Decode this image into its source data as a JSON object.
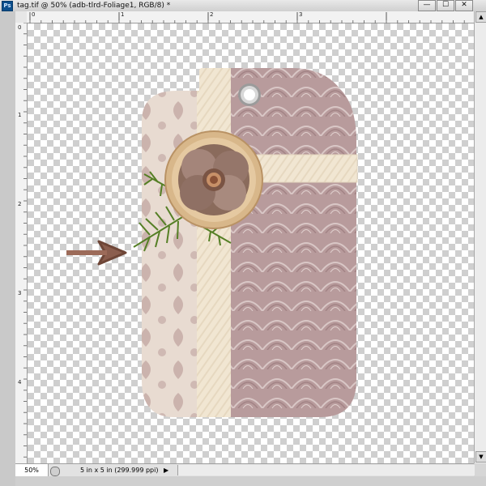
{
  "window": {
    "app_icon": "Ps",
    "title": "tag.tif @ 50% (adb-tlrd-Foliage1, RGB/8) *",
    "controls": [
      "—",
      "☐",
      "✕"
    ]
  },
  "ruler": {
    "h_labels": [
      "0",
      "1",
      "2",
      "3"
    ],
    "v_labels": [
      "0",
      "1",
      "2",
      "3",
      "4"
    ]
  },
  "status": {
    "zoom": "50%",
    "doc_info": "5 in x 5 in (299.999 ppi)",
    "arrow": "▶"
  },
  "colors": {
    "tag_left": "#e7d9d0",
    "tag_right": "#b99a9b",
    "ribbon": "#f1e6d2",
    "arrow": "#8b5e4e",
    "foliage": "#5e8a2e"
  },
  "icons": {
    "app": "photoshop-icon",
    "scroll_up": "arrow-up-icon",
    "scroll_down": "arrow-down-icon"
  }
}
